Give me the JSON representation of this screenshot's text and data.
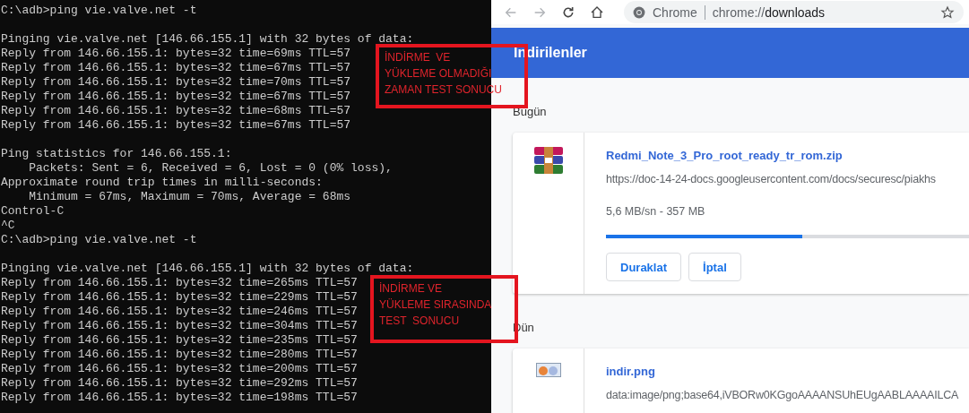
{
  "terminal": {
    "blocks": [
      [
        "C:\\adb>ping vie.valve.net -t"
      ],
      [
        "Pinging vie.valve.net [146.66.155.1] with 32 bytes of data:",
        "Reply from 146.66.155.1: bytes=32 time=69ms TTL=57",
        "Reply from 146.66.155.1: bytes=32 time=67ms TTL=57",
        "Reply from 146.66.155.1: bytes=32 time=70ms TTL=57",
        "Reply from 146.66.155.1: bytes=32 time=67ms TTL=57",
        "Reply from 146.66.155.1: bytes=32 time=68ms TTL=57",
        "Reply from 146.66.155.1: bytes=32 time=67ms TTL=57"
      ],
      [
        "Ping statistics for 146.66.155.1:",
        "    Packets: Sent = 6, Received = 6, Lost = 0 (0% loss),",
        "Approximate round trip times in milli-seconds:",
        "    Minimum = 67ms, Maximum = 70ms, Average = 68ms",
        "Control-C",
        "^C",
        "C:\\adb>ping vie.valve.net -t"
      ],
      [
        "Pinging vie.valve.net [146.66.155.1] with 32 bytes of data:",
        "Reply from 146.66.155.1: bytes=32 time=265ms TTL=57",
        "Reply from 146.66.155.1: bytes=32 time=229ms TTL=57",
        "Reply from 146.66.155.1: bytes=32 time=246ms TTL=57",
        "Reply from 146.66.155.1: bytes=32 time=304ms TTL=57",
        "Reply from 146.66.155.1: bytes=32 time=235ms TTL=57",
        "Reply from 146.66.155.1: bytes=32 time=280ms TTL=57",
        "Reply from 146.66.155.1: bytes=32 time=200ms TTL=57",
        "Reply from 146.66.155.1: bytes=32 time=292ms TTL=57",
        "Reply from 146.66.155.1: bytes=32 time=198ms TTL=57"
      ]
    ]
  },
  "browser": {
    "address_bar": {
      "site_label": "Chrome",
      "url_scheme": "chrome://",
      "url_path": "downloads"
    },
    "page_title": "Indirilenler",
    "groups": [
      {
        "heading": "Bugün",
        "items": [
          {
            "kind": "archive",
            "file_name": "Redmi_Note_3_Pro_root_ready_tr_rom.zip",
            "source": "https://doc-14-24-docs.googleusercontent.com/docs/securesc/piakhs",
            "status": "5,6 MB/sn - 357 MB",
            "level": 0.54,
            "buttons": [
              "Duraklat",
              "İptal"
            ]
          }
        ]
      },
      {
        "heading": "Dün",
        "items": [
          {
            "kind": "image",
            "file_name": "indir.png",
            "source": "data:image/png;base64,iVBORw0KGgoAAAANSUhEUgAABLAAAAILCA"
          }
        ]
      }
    ]
  },
  "annotations": [
    {
      "lines": [
        "İNDİRME  VE",
        "YÜKLEME OLMADIĞI",
        "ZAMAN TEST SONUCU"
      ]
    },
    {
      "lines": [
        "İNDİRME VE",
        "YÜKLEME SIRASINDA",
        "TEST  SONUCU"
      ]
    }
  ]
}
